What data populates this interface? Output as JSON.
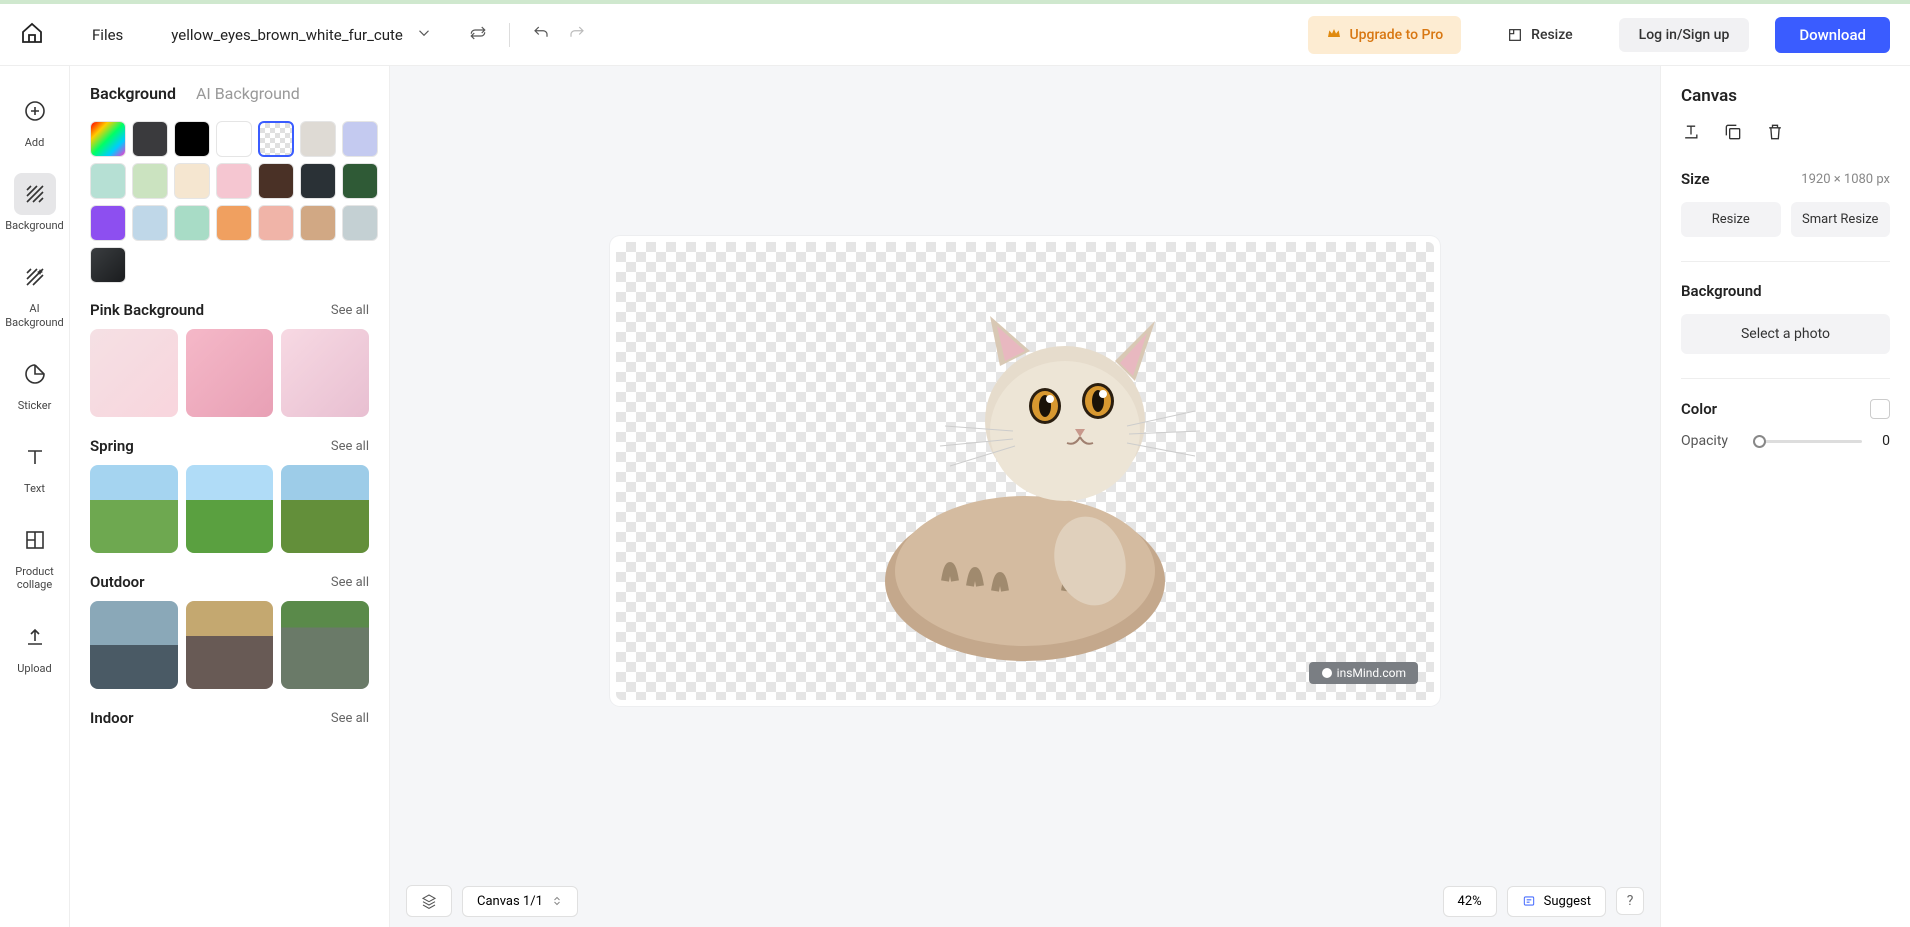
{
  "topbar": {
    "files_label": "Files",
    "filename": "yellow_eyes_brown_white_fur_cute",
    "upgrade_label": "Upgrade to Pro",
    "resize_label": "Resize",
    "login_label": "Log in/Sign up",
    "download_label": "Download"
  },
  "sidebar_icons": {
    "add": "Add",
    "background": "Background",
    "ai_background": "AI\nBackground",
    "sticker": "Sticker",
    "text": "Text",
    "product_collage": "Product\ncollage",
    "upload": "Upload"
  },
  "bg_panel": {
    "tabs": {
      "background": "Background",
      "ai_background": "AI Background"
    },
    "swatches": [
      {
        "key": "rainbow"
      },
      {
        "key": "dark-gray",
        "color": "#3a3a3d"
      },
      {
        "key": "black",
        "color": "#000"
      },
      {
        "key": "white",
        "color": "#fff"
      },
      {
        "key": "transparent",
        "selected": true
      },
      {
        "key": "light-gray",
        "color": "#dedad4"
      },
      {
        "key": "lavender",
        "color": "#c4caf0"
      },
      {
        "key": "mint",
        "color": "#b6e0d4"
      },
      {
        "key": "sage",
        "color": "#cbe3c0"
      },
      {
        "key": "cream",
        "color": "#f5e6d0"
      },
      {
        "key": "pink",
        "color": "#f5c6d1"
      },
      {
        "key": "brown",
        "color": "#4a3126"
      },
      {
        "key": "navy",
        "color": "#2a3136"
      },
      {
        "key": "forest",
        "color": "#2f5a36"
      },
      {
        "key": "purple",
        "color": "#8d4ff0"
      },
      {
        "key": "sky",
        "color": "#bfd7e8"
      },
      {
        "key": "seafoam",
        "color": "#a8dcc6"
      },
      {
        "key": "orange",
        "color": "#f0a060"
      },
      {
        "key": "rose",
        "color": "#f0b4a8"
      },
      {
        "key": "tan",
        "color": "#d1a884"
      },
      {
        "key": "slate",
        "color": "#c4d0d3"
      },
      {
        "key": "charcoal-grad",
        "color": "linear-gradient(135deg,#3a3d40,#1a1c1e)"
      }
    ],
    "categories": [
      {
        "key": "pink",
        "title": "Pink Background",
        "see_all": "See all",
        "thumbs": [
          "pink-1",
          "pink-2",
          "pink-3"
        ]
      },
      {
        "key": "spring",
        "title": "Spring",
        "see_all": "See all",
        "thumbs": [
          "spring-1",
          "spring-2",
          "spring-3"
        ]
      },
      {
        "key": "outdoor",
        "title": "Outdoor",
        "see_all": "See all",
        "thumbs": [
          "outdoor-1",
          "outdoor-2",
          "outdoor-3"
        ]
      },
      {
        "key": "indoor",
        "title": "Indoor",
        "see_all": "See all",
        "thumbs": []
      }
    ]
  },
  "canvas": {
    "watermark_text": "insMind.com",
    "bottom": {
      "canvas_label": "Canvas 1/1",
      "zoom": "42%",
      "suggest": "Suggest",
      "help": "?"
    }
  },
  "right_panel": {
    "title": "Canvas",
    "size_label": "Size",
    "size_value": "1920 × 1080 px",
    "resize_btn": "Resize",
    "smart_resize_btn": "Smart Resize",
    "background_label": "Background",
    "select_photo_btn": "Select a photo",
    "color_label": "Color",
    "opacity_label": "Opacity",
    "opacity_value": "0"
  }
}
